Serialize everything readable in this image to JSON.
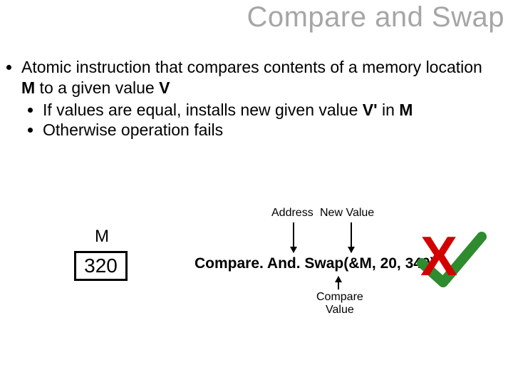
{
  "title": "Compare and Swap",
  "bullets": {
    "main_pre": "Atomic instruction that compares contents of a memory location ",
    "main_M": "M",
    "main_mid": " to a given value ",
    "main_V": "V",
    "sub1_pre": "If values are equal, installs new given value ",
    "sub1_Vp": "V'",
    "sub1_mid": " in ",
    "sub1_M": "M",
    "sub2": "Otherwise operation fails"
  },
  "diagram": {
    "m_label": "M",
    "m_value_overlay": "320",
    "label_address": "Address",
    "label_newvalue": "New Value",
    "label_compare_l1": "Compare",
    "label_compare_l2": "Value",
    "call_fn": "Compare. And. Swap(&M, 20, 340)"
  },
  "result": {
    "symbol": "X",
    "x_color": "#d20000",
    "check_color": "#2e8b2e"
  }
}
